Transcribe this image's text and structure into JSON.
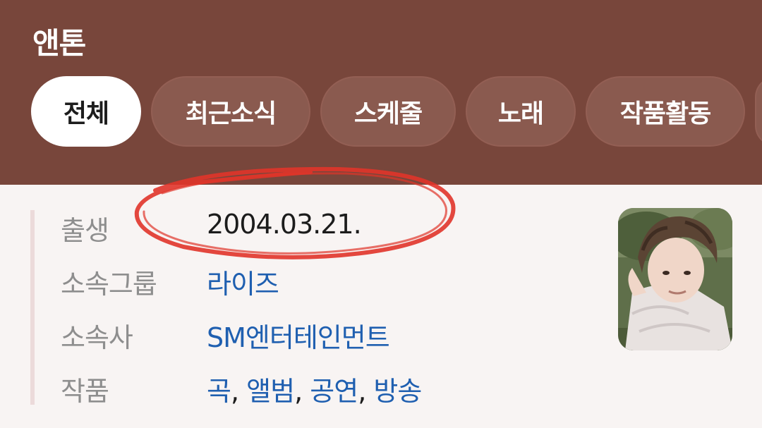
{
  "header": {
    "title": "앤톤",
    "tabs": [
      {
        "label": "전체",
        "active": true
      },
      {
        "label": "최근소식",
        "active": false
      },
      {
        "label": "스케줄",
        "active": false
      },
      {
        "label": "노래",
        "active": false
      },
      {
        "label": "작품활동",
        "active": false
      }
    ]
  },
  "profile": {
    "birth": {
      "label": "출생",
      "value": "2004.03.21."
    },
    "group": {
      "label": "소속그룹",
      "value": "라이즈"
    },
    "agency": {
      "label": "소속사",
      "value": "SM엔터테인먼트"
    },
    "works": {
      "label": "작품",
      "items": [
        "곡",
        "앨범",
        "공연",
        "방송"
      ],
      "separator": ","
    }
  },
  "colors": {
    "header_bg": "#78463b",
    "tab_bg": "#8a5a4f",
    "link": "#1f5fb0",
    "annotation": "#e0342a"
  }
}
